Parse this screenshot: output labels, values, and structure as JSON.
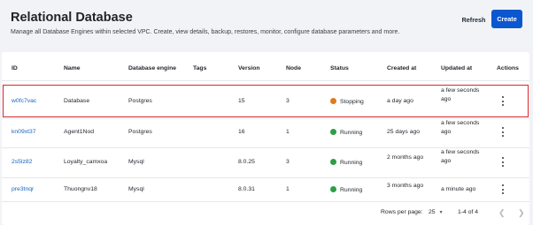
{
  "header": {
    "title": "Relational Database",
    "description": "Manage all Database Engines within selected VPC. Create, view details, backup, restores, monitor, configure database parameters and more.",
    "refresh_label": "Refresh",
    "create_label": "Create"
  },
  "table": {
    "columns": [
      "ID",
      "Name",
      "Database engine",
      "Tags",
      "Version",
      "Node",
      "Status",
      "Created at",
      "Updated at",
      "Actions"
    ],
    "rows": [
      {
        "id": "w0fc7vac",
        "name": "Database",
        "engine": "Postgres",
        "tags": "",
        "version": "15",
        "node": "3",
        "status": "Stopping",
        "created": "a day ago",
        "updated": "a few seconds ago"
      },
      {
        "id": "kn09xt37",
        "name": "Agent1Nod",
        "engine": "Postgres",
        "tags": "",
        "version": "16",
        "node": "1",
        "status": "Running",
        "created": "25 days ago",
        "updated": "a few seconds ago"
      },
      {
        "id": "2s5lz82",
        "name": "Loyalty_camxoa",
        "engine": "Mysql",
        "tags": "",
        "version": "8.0.25",
        "node": "3",
        "status": "Running",
        "created": "2 months ago",
        "updated": "a few seconds ago"
      },
      {
        "id": "pre3tnqr",
        "name": "Thuongnv18",
        "engine": "Mysql",
        "tags": "",
        "version": "8.0.31",
        "node": "1",
        "status": "Running",
        "created": "3 months ago",
        "updated": "a minute ago"
      }
    ]
  },
  "pagination": {
    "rows_per_page_label": "Rows per page:",
    "rows_per_page_value": "25",
    "range": "1-4 of 4"
  },
  "colors": {
    "accent": "#0b57d0",
    "link": "#1565c0",
    "running": "#2e9e44",
    "stopping": "#e07a1f",
    "highlight": "#d9262b"
  }
}
